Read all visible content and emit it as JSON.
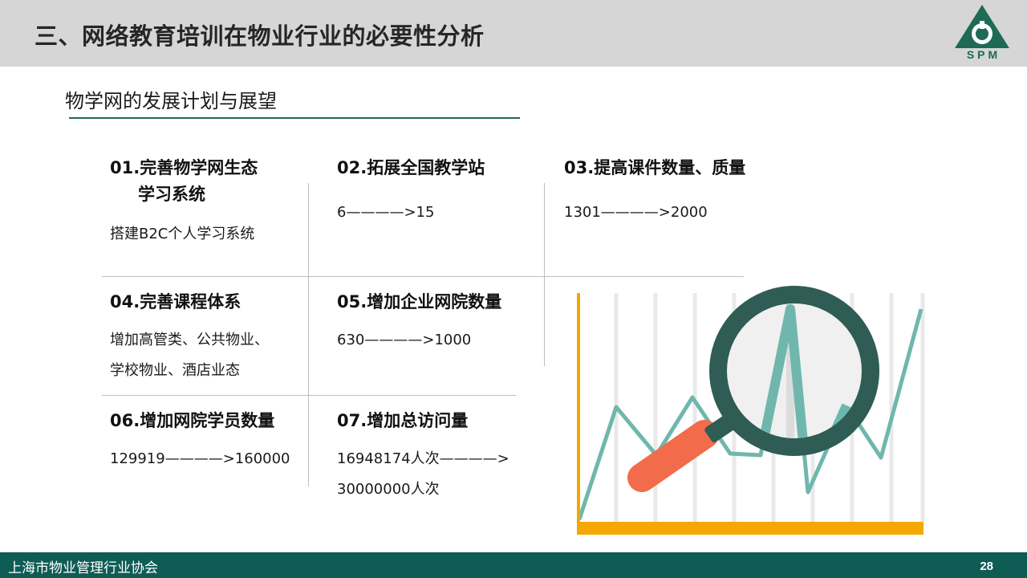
{
  "header": {
    "title": "三、网络教育培训在物业行业的必要性分析",
    "logo_text": "SPM"
  },
  "subtitle": "物学网的发展计划与展望",
  "items": [
    {
      "title_line1": "01.完善物学网生态",
      "title_line2": "学习系统",
      "desc": [
        "搭建B2C个人学习系统"
      ]
    },
    {
      "title_line1": "02.拓展全国教学站",
      "desc": [
        "6————>15"
      ]
    },
    {
      "title_line1": "03.提高课件数量、质量",
      "desc": [
        "1301————>2000"
      ]
    },
    {
      "title_line1": "04.完善课程体系",
      "desc": [
        "增加高管类、公共物业、",
        "学校物业、酒店业态"
      ]
    },
    {
      "title_line1": "05.增加企业网院数量",
      "desc": [
        "630————>1000"
      ]
    },
    {
      "title_line1": "06.增加网院学员数量",
      "desc": [
        "129919————>160000"
      ]
    },
    {
      "title_line1": "07.增加总访问量",
      "desc": [
        "16948174人次————>",
        "30000000人次"
      ]
    }
  ],
  "illustration": {
    "icon": "magnifier-over-line-chart-icon",
    "colors": {
      "axis": "#f5a800",
      "line": "#6fb7ad",
      "lens_frame": "#2f5c55",
      "handle": "#f26b4a"
    }
  },
  "footer": {
    "organization": "上海市物业管理行业协会",
    "page_number": "28"
  },
  "colors": {
    "header_bg": "#d6d6d6",
    "accent": "#1e6a55",
    "footer_bg": "#0f5c55"
  }
}
